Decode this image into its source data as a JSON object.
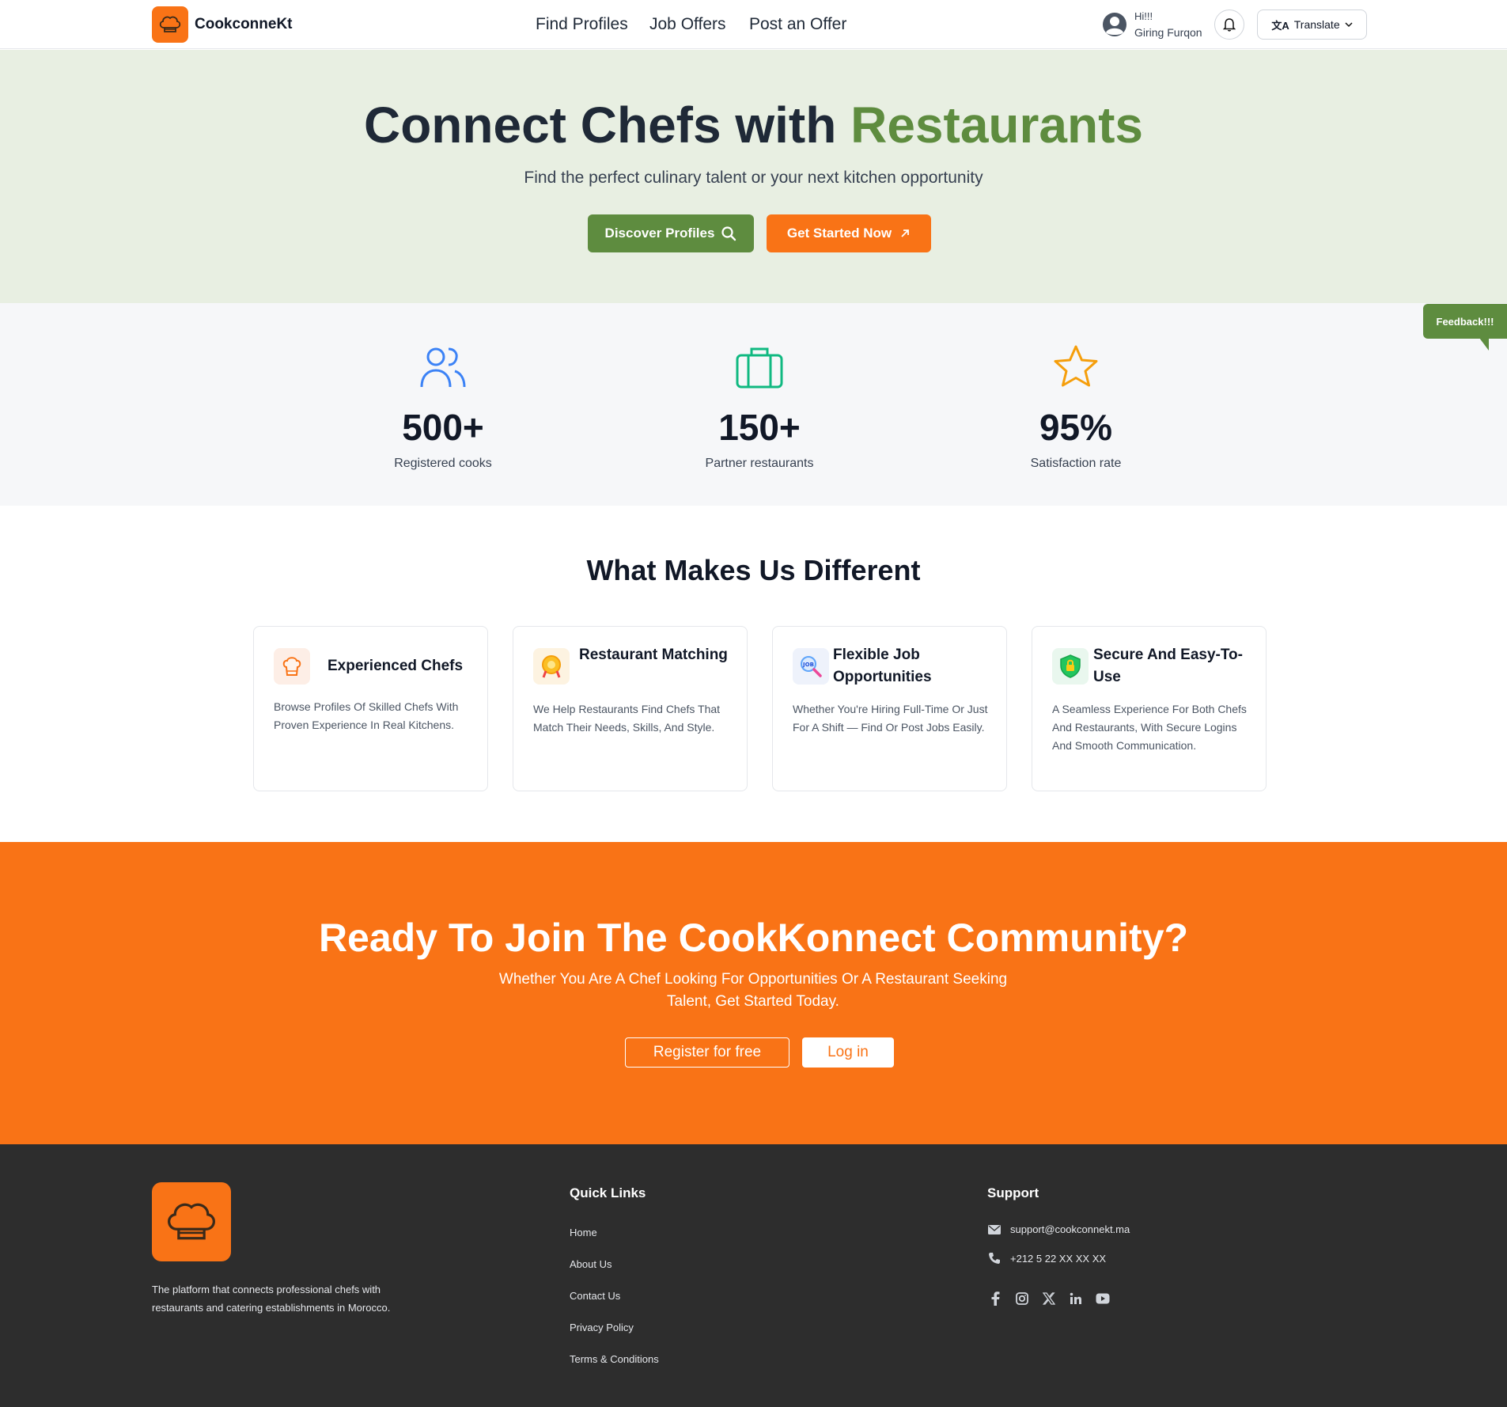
{
  "header": {
    "brand": "CookconneKt",
    "nav": [
      "Find Profiles",
      "Job Offers",
      "Post an Offer"
    ],
    "greeting": "Hi!!!",
    "user_name": "Giring Furqon",
    "translate_label": "Translate"
  },
  "hero": {
    "title_main": "Connect Chefs with ",
    "title_accent": "Restaurants",
    "subtitle": "Find the perfect culinary talent or your next kitchen opportunity",
    "discover_label": "Discover Profiles",
    "get_started_label": "Get Started Now"
  },
  "stats": [
    {
      "value": "500+",
      "label": "Registered cooks",
      "icon": "users-icon"
    },
    {
      "value": "150+",
      "label": "Partner restaurants",
      "icon": "briefcase-icon"
    },
    {
      "value": "95%",
      "label": "Satisfaction rate",
      "icon": "star-icon"
    }
  ],
  "feedback_label": "Feedback!!!",
  "features": {
    "title": "What Makes Us Different",
    "cards": [
      {
        "title": "Experienced Chefs",
        "desc": "Browse Profiles Of Skilled Chefs With Proven Experience In Real Kitchens.",
        "icon": "chef-hat-icon"
      },
      {
        "title": "Restaurant Matching",
        "desc": "We Help Restaurants Find Chefs That Match Their Needs, Skills, And Style.",
        "icon": "match-badge-icon"
      },
      {
        "title": "Flexible Job Opportunities",
        "desc": "Whether You're Hiring Full-Time Or Just For A Shift — Find Or Post Jobs Easily.",
        "icon": "job-search-icon"
      },
      {
        "title": "Secure And Easy-To-Use",
        "desc": "A Seamless Experience For Both Chefs And Restaurants, With Secure Logins And Smooth Communication.",
        "icon": "shield-icon"
      }
    ]
  },
  "cta": {
    "title": "Ready To Join The CookKonnect Community?",
    "subtitle": "Whether You Are A Chef Looking For Opportunities Or A Restaurant Seeking Talent, Get Started Today.",
    "register_label": "Register for free",
    "login_label": "Log in"
  },
  "footer": {
    "description": "The platform that connects professional chefs with restaurants and catering establishments in Morocco.",
    "quick_links_title": "Quick Links",
    "quick_links": [
      "Home",
      "About Us",
      "Contact Us",
      "Privacy Policy",
      "Terms & Conditions"
    ],
    "support_title": "Support",
    "email": "support@cookconnekt.ma",
    "phone": "+212 5 22 XX XX XX",
    "socials": [
      "facebook-icon",
      "instagram-icon",
      "x-icon",
      "linkedin-icon",
      "youtube-icon"
    ]
  },
  "colors": {
    "brand_orange": "#f97316",
    "brand_green": "#5e8c3f",
    "hero_bg": "#e8efe2",
    "footer_bg": "#2d2d2d"
  }
}
